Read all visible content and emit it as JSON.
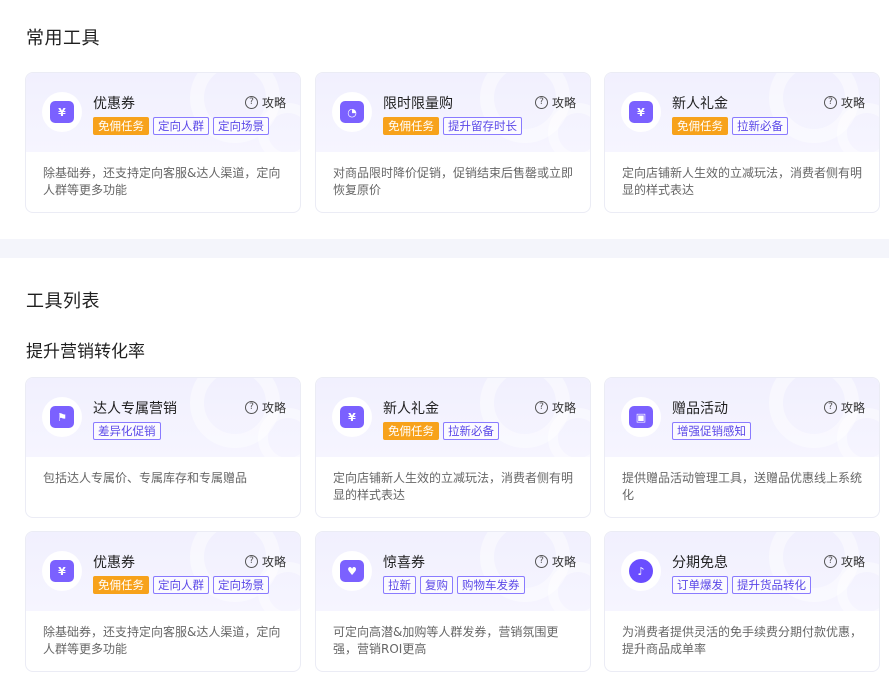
{
  "sections": {
    "common_tools": "常用工具",
    "tool_list": "工具列表",
    "improve_conversion": "提升营销转化率"
  },
  "guide_label": "攻略",
  "cards": [
    {
      "title": "优惠券",
      "icon": "ticket-icon",
      "icon_glyph": "¥",
      "tags": [
        {
          "label": "免佣任务",
          "style": "orange"
        },
        {
          "label": "定向人群",
          "style": "outline"
        },
        {
          "label": "定向场景",
          "style": "outline"
        }
      ],
      "desc": "除基础券，还支持定向客服&达人渠道，定向人群等更多功能"
    },
    {
      "title": "限时限量购",
      "icon": "shopping-bag-clock-icon",
      "icon_glyph": "◔",
      "tags": [
        {
          "label": "免佣任务",
          "style": "orange"
        },
        {
          "label": "提升留存时长",
          "style": "outline"
        }
      ],
      "desc": "对商品限时降价促销，促销结束后售罄或立即恢复原价"
    },
    {
      "title": "新人礼金",
      "icon": "red-packet-icon",
      "icon_glyph": "¥",
      "tags": [
        {
          "label": "免佣任务",
          "style": "orange"
        },
        {
          "label": "拉新必备",
          "style": "outline"
        }
      ],
      "desc": "定向店铺新人生效的立减玩法，消费者侧有明显的样式表达"
    },
    {
      "title": "达人专属营销",
      "icon": "flag-icon",
      "icon_glyph": "⚑",
      "tags": [
        {
          "label": "差异化促销",
          "style": "outline"
        }
      ],
      "desc": "包括达人专属价、专属库存和专属赠品"
    },
    {
      "title": "新人礼金",
      "icon": "red-packet-icon",
      "icon_glyph": "¥",
      "tags": [
        {
          "label": "免佣任务",
          "style": "orange"
        },
        {
          "label": "拉新必备",
          "style": "outline"
        }
      ],
      "desc": "定向店铺新人生效的立减玩法，消费者侧有明显的样式表达"
    },
    {
      "title": "赠品活动",
      "icon": "gift-icon",
      "icon_glyph": "▣",
      "tags": [
        {
          "label": "增强促销感知",
          "style": "outline"
        }
      ],
      "desc": "提供赠品活动管理工具，送赠品优惠线上系统化"
    },
    {
      "title": "优惠券",
      "icon": "ticket-icon",
      "icon_glyph": "¥",
      "tags": [
        {
          "label": "免佣任务",
          "style": "orange"
        },
        {
          "label": "定向人群",
          "style": "outline"
        },
        {
          "label": "定向场景",
          "style": "outline"
        }
      ],
      "desc": "除基础券，还支持定向客服&达人渠道，定向人群等更多功能"
    },
    {
      "title": "惊喜券",
      "icon": "heart-ticket-icon",
      "icon_glyph": "♥",
      "tags": [
        {
          "label": "拉新",
          "style": "outline"
        },
        {
          "label": "复购",
          "style": "outline"
        },
        {
          "label": "购物车发券",
          "style": "outline"
        }
      ],
      "desc": "可定向高潜&加购等人群发券，营销氛围更强，营销ROI更高"
    },
    {
      "title": "分期免息",
      "icon": "tiktok-logo-icon",
      "icon_glyph": "♪",
      "tags": [
        {
          "label": "订单爆发",
          "style": "outline"
        },
        {
          "label": "提升货品转化",
          "style": "outline"
        }
      ],
      "desc": "为消费者提供灵活的免手续费分期付款优惠，提升商品成单率"
    }
  ]
}
